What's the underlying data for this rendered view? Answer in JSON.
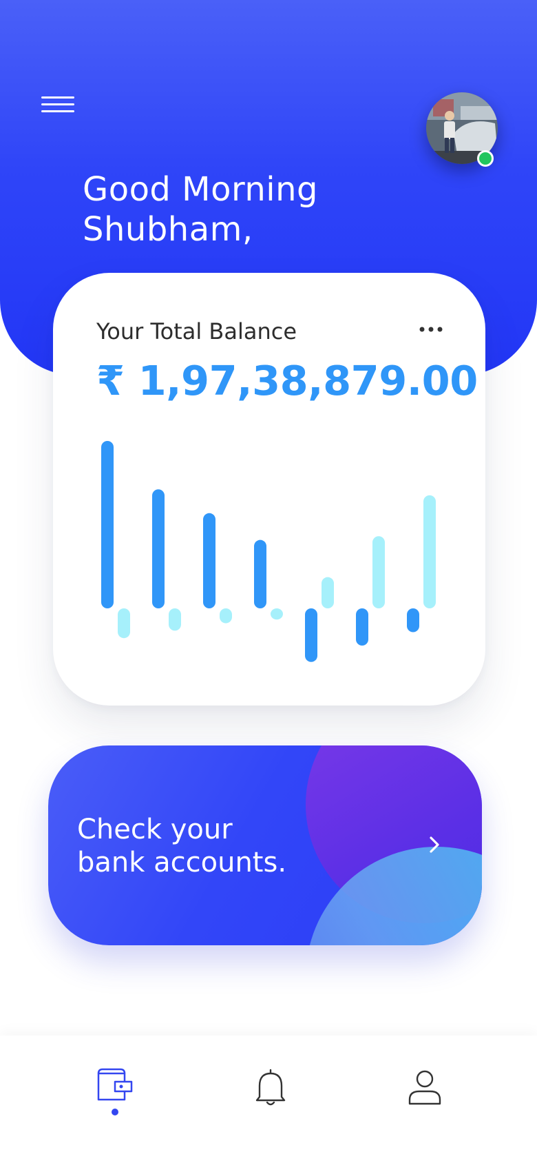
{
  "header": {
    "menu_icon": "hamburger-menu-icon",
    "greeting_line1": "Good Morning",
    "greeting_line2": "Shubham,",
    "avatar_icon": "user-avatar-photo",
    "status": "online",
    "gradient_top": "#4a60f8",
    "gradient_bottom": "#2236f6"
  },
  "balance_card": {
    "label": "Your Total Balance",
    "amount": "₹ 1,97,38,879.00",
    "amount_color": "#2f96f8",
    "more_icon": "more-dots-icon"
  },
  "chart_data": {
    "type": "bar",
    "categories": [
      "",
      "",
      "",
      "",
      "",
      "",
      ""
    ],
    "series": [
      {
        "color": "#3096f8",
        "values": [
          225,
          160,
          128,
          92,
          -72,
          -50,
          -32
        ]
      },
      {
        "color": "#a6f0fb",
        "values": [
          -40,
          -30,
          -20,
          -15,
          42,
          97,
          152
        ]
      }
    ],
    "ylim": [
      -80,
      230
    ],
    "grid": false,
    "legend": "none"
  },
  "promo_card": {
    "line1": "Check your",
    "line2": "bank accounts.",
    "arrow_icon": "chevron-right-icon"
  },
  "bottom_nav": {
    "items": [
      {
        "icon": "wallet-icon",
        "active": true
      },
      {
        "icon": "bell-icon",
        "active": false
      },
      {
        "icon": "user-icon",
        "active": false
      }
    ],
    "active_color": "#3346f0",
    "inactive_color": "#333333"
  }
}
